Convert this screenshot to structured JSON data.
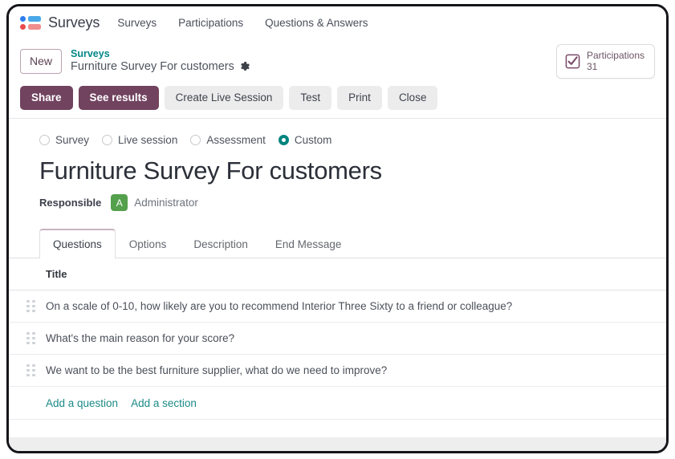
{
  "app": {
    "brand": "Surveys",
    "logo_icon": "surveys-logo-icon"
  },
  "navbar": {
    "items": [
      {
        "label": "Surveys",
        "name": "nav-surveys"
      },
      {
        "label": "Participations",
        "name": "nav-participations"
      },
      {
        "label": "Questions & Answers",
        "name": "nav-questions-answers"
      }
    ]
  },
  "control_panel": {
    "new_button": "New",
    "breadcrumb": {
      "parent": "Surveys",
      "current": "Furniture Survey For customers",
      "settings_icon": "gear-icon"
    },
    "stat_button": {
      "icon": "checkbox-checked-icon",
      "label": "Participations",
      "value": "31"
    }
  },
  "actions": [
    {
      "label": "Share",
      "style": "primary",
      "name": "share-button"
    },
    {
      "label": "See results",
      "style": "primary",
      "name": "see-results-button"
    },
    {
      "label": "Create Live Session",
      "style": "secondary",
      "name": "create-live-session-button"
    },
    {
      "label": "Test",
      "style": "secondary",
      "name": "test-button"
    },
    {
      "label": "Print",
      "style": "secondary",
      "name": "print-button"
    },
    {
      "label": "Close",
      "style": "secondary",
      "name": "close-button"
    }
  ],
  "form": {
    "survey_type": {
      "options": [
        {
          "label": "Survey",
          "checked": false,
          "name": "radio-survey"
        },
        {
          "label": "Live session",
          "checked": false,
          "name": "radio-live-session"
        },
        {
          "label": "Assessment",
          "checked": false,
          "name": "radio-assessment"
        },
        {
          "label": "Custom",
          "checked": true,
          "name": "radio-custom"
        }
      ]
    },
    "title": "Furniture Survey For customers",
    "responsible": {
      "label": "Responsible",
      "avatar_initial": "A",
      "name": "Administrator"
    }
  },
  "notebook": {
    "tabs": [
      {
        "label": "Questions",
        "active": true,
        "name": "tab-questions"
      },
      {
        "label": "Options",
        "active": false,
        "name": "tab-options"
      },
      {
        "label": "Description",
        "active": false,
        "name": "tab-description"
      },
      {
        "label": "End Message",
        "active": false,
        "name": "tab-end-message"
      }
    ]
  },
  "questions_table": {
    "column_header": "Title",
    "rows": [
      {
        "title": "On a scale of 0-10, how likely are you to recommend Interior Three Sixty to a friend or colleague?"
      },
      {
        "title": "What's the main reason for your score?"
      },
      {
        "title": "We want to be the best furniture supplier, what do we need to improve?"
      }
    ],
    "add_question_link": "Add a question",
    "add_section_link": "Add a section"
  },
  "colors": {
    "primary": "#71435f",
    "accent_teal": "#01847f",
    "avatar_green": "#54a04c",
    "secondary_button": "#ececed"
  }
}
